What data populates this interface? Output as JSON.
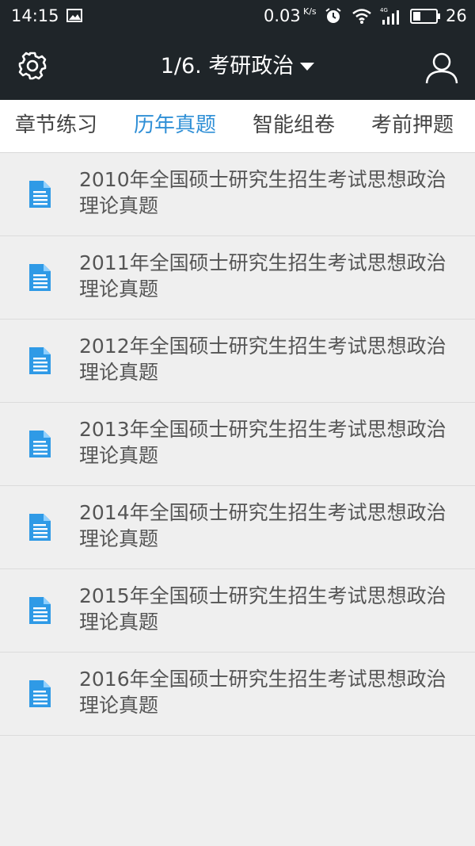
{
  "status_bar": {
    "time": "14:15",
    "network_speed": "0.03",
    "network_speed_unit": "K/s",
    "network_type": "4G",
    "battery": "26",
    "icons": [
      "image-icon",
      "alarm-icon",
      "wifi-icon",
      "signal-icon",
      "battery-icon"
    ]
  },
  "app_bar": {
    "title": "1/6. 考研政治",
    "settings_icon": "gear-icon",
    "dropdown_icon": "caret-down-icon",
    "user_icon": "user-icon"
  },
  "tabs": [
    {
      "label": "章节练习",
      "active": false
    },
    {
      "label": "历年真题",
      "active": true
    },
    {
      "label": "智能组卷",
      "active": false
    },
    {
      "label": "考前押题",
      "active": false
    }
  ],
  "list": [
    {
      "title": "2010年全国硕士研究生招生考试思想政治理论真题",
      "icon": "document-icon"
    },
    {
      "title": "2011年全国硕士研究生招生考试思想政治理论真题",
      "icon": "document-icon"
    },
    {
      "title": "2012年全国硕士研究生招生考试思想政治理论真题",
      "icon": "document-icon"
    },
    {
      "title": "2013年全国硕士研究生招生考试思想政治理论真题",
      "icon": "document-icon"
    },
    {
      "title": "2014年全国硕士研究生招生考试思想政治理论真题",
      "icon": "document-icon"
    },
    {
      "title": "2015年全国硕士研究生招生考试思想政治理论真题",
      "icon": "document-icon"
    },
    {
      "title": "2016年全国硕士研究生招生考试思想政治理论真题",
      "icon": "document-icon"
    }
  ],
  "colors": {
    "header_background": "#1f2529",
    "active_tab": "#2f8fd6",
    "tab_text": "#444444",
    "list_background": "#efefef",
    "list_text": "#555555",
    "document_icon": "#2f9ae6"
  }
}
